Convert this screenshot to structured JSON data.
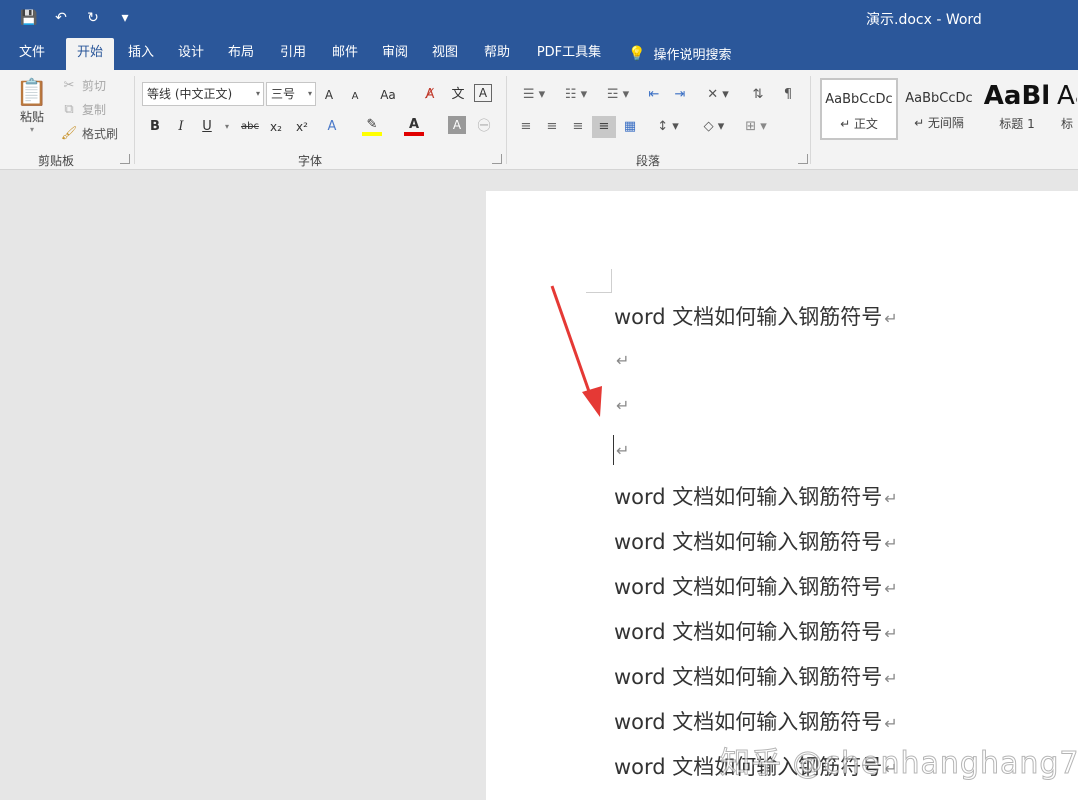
{
  "window": {
    "title": "演示.docx - Word"
  },
  "qat": {
    "save": "💾",
    "undo": "↶",
    "redo": "↻",
    "customize": "▾"
  },
  "tabs": [
    "文件",
    "开始",
    "插入",
    "设计",
    "布局",
    "引用",
    "邮件",
    "审阅",
    "视图",
    "帮助",
    "PDF工具集"
  ],
  "tell_me": "操作说明搜索",
  "clipboard": {
    "paste": "粘贴",
    "cut": "剪切",
    "copy": "复制",
    "format_painter": "格式刷",
    "label": "剪贴板"
  },
  "font": {
    "name": "等线 (中文正文)",
    "size": "三号",
    "label": "字体",
    "grow": "A",
    "shrink": "A",
    "case": "Aa",
    "bold": "B",
    "italic": "I",
    "underline": "U",
    "strike": "abc",
    "sub": "x₂",
    "sup": "x²",
    "color_letter": "A",
    "highlight_letter": "A",
    "border_letter": "A"
  },
  "paragraph": {
    "label": "段落"
  },
  "styles": [
    {
      "preview": "AaBbCcDc",
      "name": "↵ 正文"
    },
    {
      "preview": "AaBbCcDc",
      "name": "↵ 无间隔"
    },
    {
      "preview": "AaBl",
      "name": "标题 1"
    },
    {
      "preview": "Aa",
      "name": "标"
    }
  ],
  "document": {
    "lines": [
      "word 文档如何输入钢筋符号",
      "",
      "",
      "",
      "word 文档如何输入钢筋符号",
      "word 文档如何输入钢筋符号",
      "word 文档如何输入钢筋符号",
      "word 文档如何输入钢筋符号",
      "word 文档如何输入钢筋符号",
      "word 文档如何输入钢筋符号",
      "word 文档如何输入钢筋符号"
    ],
    "para_mark": "↵"
  },
  "watermark": "知乎 @chenhanghang7",
  "colors": {
    "title_bar": "#2b579a",
    "arrow": "#e53935",
    "font_color_bar": "#e00000",
    "highlight_bar": "#ffff00"
  }
}
